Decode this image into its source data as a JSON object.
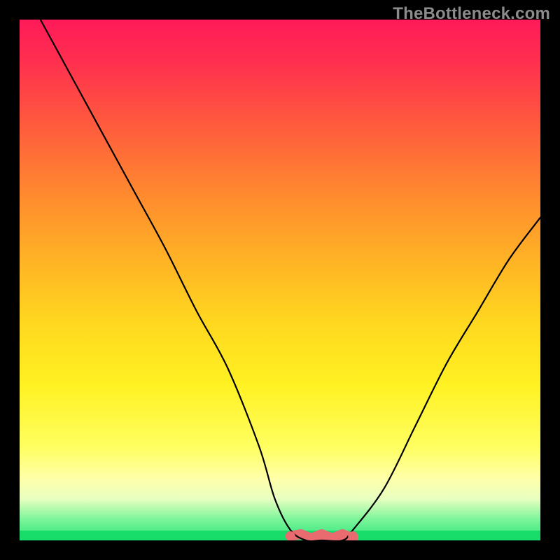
{
  "watermark": "TheBottleneck.com",
  "chart_data": {
    "type": "line",
    "title": "",
    "xlabel": "",
    "ylabel": "",
    "xlim": [
      0,
      100
    ],
    "ylim": [
      0,
      100
    ],
    "series": [
      {
        "name": "bottleneck-curve",
        "x": [
          4,
          10,
          16,
          22,
          28,
          34,
          40,
          46,
          49,
          52,
          55,
          58,
          62,
          64,
          70,
          76,
          82,
          88,
          94,
          100
        ],
        "y": [
          100,
          89,
          78,
          67,
          56,
          44,
          33,
          18,
          8,
          2,
          0,
          0,
          0,
          2,
          10,
          22,
          34,
          44,
          54,
          62
        ]
      }
    ],
    "annotations": [
      {
        "name": "optimal-flat-region",
        "x_range": [
          52,
          64
        ],
        "color": "#e96a6f"
      }
    ],
    "background_gradient": {
      "orientation": "vertical",
      "stops": [
        {
          "pos": 0.0,
          "color": "#ff1a59"
        },
        {
          "pos": 0.2,
          "color": "#ff5a3e"
        },
        {
          "pos": 0.46,
          "color": "#ffb225"
        },
        {
          "pos": 0.7,
          "color": "#fff122"
        },
        {
          "pos": 0.92,
          "color": "#e8ffc0"
        },
        {
          "pos": 1.0,
          "color": "#18dd6a"
        }
      ]
    }
  }
}
